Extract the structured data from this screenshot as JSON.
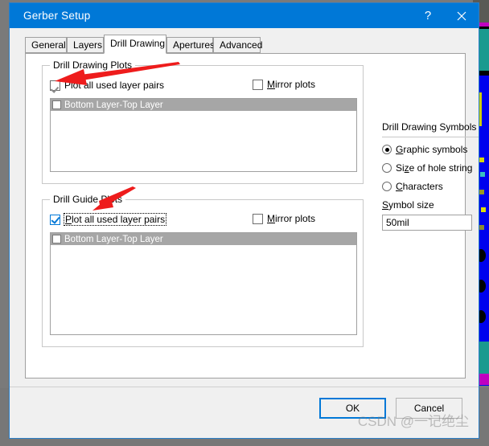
{
  "window": {
    "title": "Gerber Setup",
    "help_label": "?",
    "close_label": "✕"
  },
  "tabs": [
    {
      "label": "General",
      "active": false
    },
    {
      "label": "Layers",
      "active": false
    },
    {
      "label": "Drill Drawing",
      "active": true
    },
    {
      "label": "Apertures",
      "active": false
    },
    {
      "label": "Advanced",
      "active": false
    }
  ],
  "drill_drawing_plots": {
    "group_title": "Drill Drawing Plots",
    "plot_all_label": "Plot all used layer pairs",
    "plot_all_checked": true,
    "mirror_label": "Mirror plots",
    "mirror_checked": false,
    "layer_pairs": [
      {
        "label": "Bottom Layer-Top Layer",
        "checked": false,
        "selected": true
      }
    ]
  },
  "drill_guide_plots": {
    "group_title": "Drill Guide Plots",
    "plot_all_label": "Plot all used layer pairs",
    "plot_all_checked": true,
    "mirror_label": "Mirror plots",
    "mirror_checked": false,
    "layer_pairs": [
      {
        "label": "Bottom Layer-Top Layer",
        "checked": false,
        "selected": true
      }
    ]
  },
  "drill_drawing_symbols": {
    "title": "Drill Drawing Symbols",
    "options": [
      {
        "label": "Graphic symbols",
        "selected": true
      },
      {
        "label": "Size of hole string",
        "selected": false
      },
      {
        "label": "Characters",
        "selected": false
      }
    ],
    "symbol_size_label": "Symbol size",
    "symbol_size_value": "50mil"
  },
  "footer": {
    "ok_label": "OK",
    "cancel_label": "Cancel"
  },
  "watermark": {
    "text": "CSDN @一记绝尘"
  },
  "colors": {
    "titlebar": "#0078d7",
    "accent": "#0078d7",
    "dialog_bg": "#f0f0f0",
    "page_bg": "#ffffff",
    "selected_row": "#a6a6a6",
    "annotation_arrow": "#ee1c1c"
  }
}
